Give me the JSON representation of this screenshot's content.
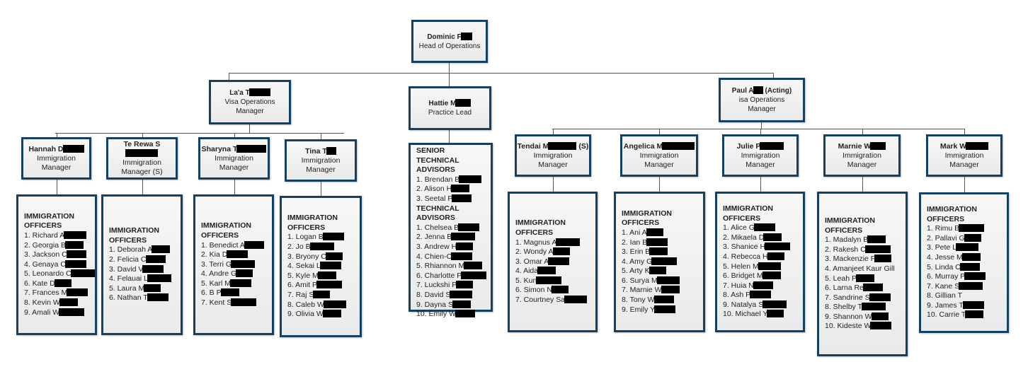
{
  "head": {
    "name": "Dominic F",
    "role": "Head of Operations"
  },
  "second": [
    {
      "name": "La'a T",
      "role": "Visa Operations Manager"
    },
    {
      "name": "Hattie M",
      "role": "Practice Lead"
    },
    {
      "name": "Paul A",
      "suffix": "(Acting)",
      "role": "isa Operations Manager"
    }
  ],
  "practice": {
    "senior_heading": "SENIOR TECHNICAL ADVISORS",
    "senior": [
      "1.  Brendan B",
      "2.  Alison H",
      "3.  Seetal P"
    ],
    "tech_heading": "TECHNICAL ADVISORS",
    "tech": [
      "1.  Chelsea B",
      "2.  Jenna B",
      "3.  Andrew H",
      "4. Chien-C",
      "5.  Rhiannon M",
      "6.  Charlotte P",
      "7.  Luckshi P",
      "8.  David S",
      "9.  Dayna S",
      "10. Emily W"
    ]
  },
  "officers_heading": "IMMIGRATION OFFICERS",
  "teams": [
    {
      "manager": "Hannah D",
      "suffix": "",
      "role": "Immigration Manager",
      "officers": [
        "1.  Richard A",
        "2.  Georgia B",
        "3.  Jackson C",
        "4.  Genaya C",
        "5.  Leonardo C",
        "6.  Kate D",
        "7.  Frances M",
        "8.  Kevin W",
        "9.  Amali W"
      ]
    },
    {
      "manager": "Te Rewa S",
      "suffix": "",
      "role": "Immigration Manager (S)",
      "officers": [
        "1.  Deborah A",
        "2.  Felicia C",
        "3.  David V",
        "4.  Felauai L",
        "5.  Laura M",
        "6.  Nathan T"
      ]
    },
    {
      "manager": "Sharyna T",
      "suffix": "",
      "role": "Immigration Manager",
      "officers": [
        "1.  Benedict A",
        "2.  Kia D",
        "3.  Terri G",
        "4.  Andre G",
        "5.  Karl M",
        "6.  B P",
        "7.  Kent S"
      ]
    },
    {
      "manager": "Tina T",
      "suffix": "",
      "role": "Immigration Manager",
      "officers": [
        "1.  Logan B",
        "2.  Jo B",
        "3.  Bryony C",
        "4.  Sekai L",
        "5.  Kyle M",
        "6.  Amit P",
        "7.  Raj S",
        "8.  Caleb W",
        "9.  Olivia W"
      ]
    },
    {
      "manager": "Tendai M",
      "suffix": "(S)",
      "role": "Immigration Manager",
      "officers": [
        "1.  Magnus A",
        "2.  Wondy A",
        "3.  Omar A",
        "4.  Aida",
        "5.  Kun",
        "6.  Simon N",
        "7.  Courtney Sa"
      ]
    },
    {
      "manager": "Angelica M",
      "suffix": "",
      "role": "Immigration Manager",
      "officers": [
        "1.  Ani A",
        "2.  Ian B",
        "3.  Erin B",
        "4.  Amy G",
        "5.  Arty K",
        "6.  Surya M",
        "7.  Marnie W",
        "8.  Tony W",
        "9.  Emily Y"
      ]
    },
    {
      "manager": "Julie P",
      "suffix": "",
      "role": "Immigration Manager",
      "officers": [
        "1.  Alice G",
        "2.  Mikaela D",
        "3.  Shanice H",
        "4.  Rebecca H",
        "5.  Helen M",
        "6.  Bridget M",
        "7.  Huia N",
        "8.  Ash P",
        "9.  Natalya S",
        "10. Michael Y"
      ]
    },
    {
      "manager": "Marnie W",
      "suffix": "",
      "role": "Immigration Manager",
      "officers": [
        "1.  Madalyn B",
        "2.  Rakesh C",
        "3.  Mackenzie F",
        "4.  Amanjeet Kaur Gill",
        "5.  Leah P",
        "6.  Larna Re",
        "7.  Sandrine S",
        "8.  Shelby T",
        "9.  Shannon W",
        "10. Kideste W"
      ]
    },
    {
      "manager": "Mark W",
      "suffix": "",
      "role": "Immigration Manager",
      "officers": [
        "1.  Rimu B",
        "2.  Pallavi G",
        "3.  Pete L",
        "4.  Jesse M",
        "5.  Linda O",
        "6.  Murray P",
        "7.  Kane S",
        "8.  Gillian T",
        "9.  James T",
        "10. Carrie T"
      ]
    }
  ],
  "colors": {
    "border": "#17405e",
    "fill": "#efefef",
    "redaction": "#000000",
    "connector": "#555555"
  }
}
